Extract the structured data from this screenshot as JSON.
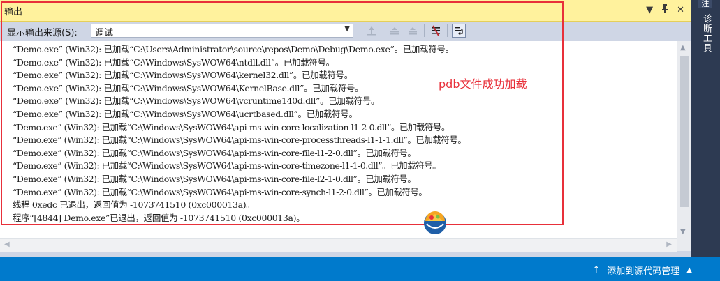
{
  "panel": {
    "title": "输出",
    "menu_icon": "dropdown-arrow-icon",
    "pin_icon": "pin-icon",
    "close_icon": "close-icon",
    "pin_glyph": "ᵖ",
    "close_glyph": "✕",
    "menu_glyph": "▼"
  },
  "toolbar": {
    "source_label": "显示输出来源(S):",
    "source_value": "调试"
  },
  "output": {
    "lines": [
      "“Demo.exe” (Win32): 已加载“C:\\Users\\Administrator\\source\\repos\\Demo\\Debug\\Demo.exe”。已加载符号。",
      "“Demo.exe” (Win32): 已加载“C:\\Windows\\SysWOW64\\ntdll.dll”。已加载符号。",
      "“Demo.exe” (Win32): 已加载“C:\\Windows\\SysWOW64\\kernel32.dll”。已加载符号。",
      "“Demo.exe” (Win32): 已加载“C:\\Windows\\SysWOW64\\KernelBase.dll”。已加载符号。",
      "“Demo.exe” (Win32): 已加载“C:\\Windows\\SysWOW64\\vcruntime140d.dll”。已加载符号。",
      "“Demo.exe” (Win32): 已加载“C:\\Windows\\SysWOW64\\ucrtbased.dll”。已加载符号。",
      "“Demo.exe” (Win32): 已加载“C:\\Windows\\SysWOW64\\api-ms-win-core-localization-l1-2-0.dll”。已加载符号。",
      "“Demo.exe” (Win32): 已加载“C:\\Windows\\SysWOW64\\api-ms-win-core-processthreads-l1-1-1.dll”。已加载符号。",
      "“Demo.exe” (Win32): 已加载“C:\\Windows\\SysWOW64\\api-ms-win-core-file-l1-2-0.dll”。已加载符号。",
      "“Demo.exe” (Win32): 已加载“C:\\Windows\\SysWOW64\\api-ms-win-core-timezone-l1-1-0.dll”。已加载符号。",
      "“Demo.exe” (Win32): 已加载“C:\\Windows\\SysWOW64\\api-ms-win-core-file-l2-1-0.dll”。已加载符号。",
      "“Demo.exe” (Win32): 已加载“C:\\Windows\\SysWOW64\\api-ms-win-core-synch-l1-2-0.dll”。已加载符号。",
      "线程 0xedc 已退出，返回值为 -1073741510 (0xc000013a)。",
      "程序“[4844] Demo.exe”已退出，返回值为 -1073741510 (0xc000013a)。"
    ],
    "annotation": "pdb文件成功加载",
    "highlight_color": "#e8303a"
  },
  "side": {
    "tab_top": "注",
    "tab_label": "诊断工具"
  },
  "statusbar": {
    "label": "添加到源代码管理",
    "up_glyph": "↑",
    "caret_glyph": "▲",
    "color": "#007acc"
  }
}
